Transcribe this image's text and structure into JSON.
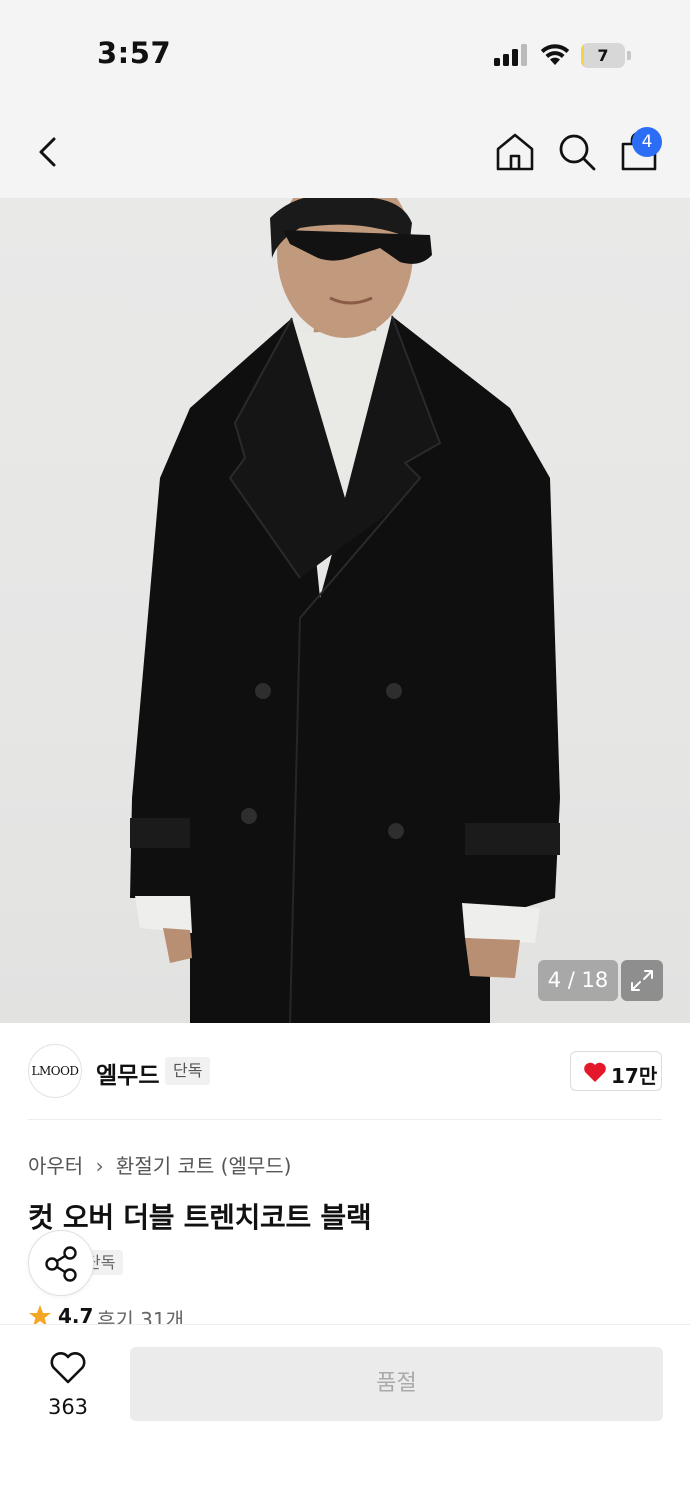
{
  "status_bar": {
    "time": "3:57",
    "battery_level": "7",
    "battery_fraction": 0.07
  },
  "nav": {
    "back_icon": "chevron-left-icon",
    "home_icon": "home-icon",
    "search_icon": "search-icon",
    "cart_icon": "shopping-bag-icon",
    "cart_count": "4"
  },
  "gallery": {
    "counter": "4 / 18",
    "expand_icon": "expand-icon"
  },
  "brand": {
    "logo_text": "LMOOD",
    "name": "엘무드",
    "tag": "단독",
    "likes": "17만",
    "like_icon": "heart-icon",
    "accent_color": "#e4182b"
  },
  "product": {
    "breadcrumb": [
      "아우터",
      "환절기 코트 (엘무드)"
    ],
    "title": "컷 오버 더블 트렌치코트 블랙",
    "exclusive_tag": "단독",
    "rating": "4.7",
    "reviews": "후기 31개",
    "share_icon": "share-icon",
    "star_color": "#f5a623"
  },
  "bottom_bar": {
    "wish_count": "363",
    "wish_icon": "heart-outline-icon",
    "soldout_label": "품절"
  }
}
